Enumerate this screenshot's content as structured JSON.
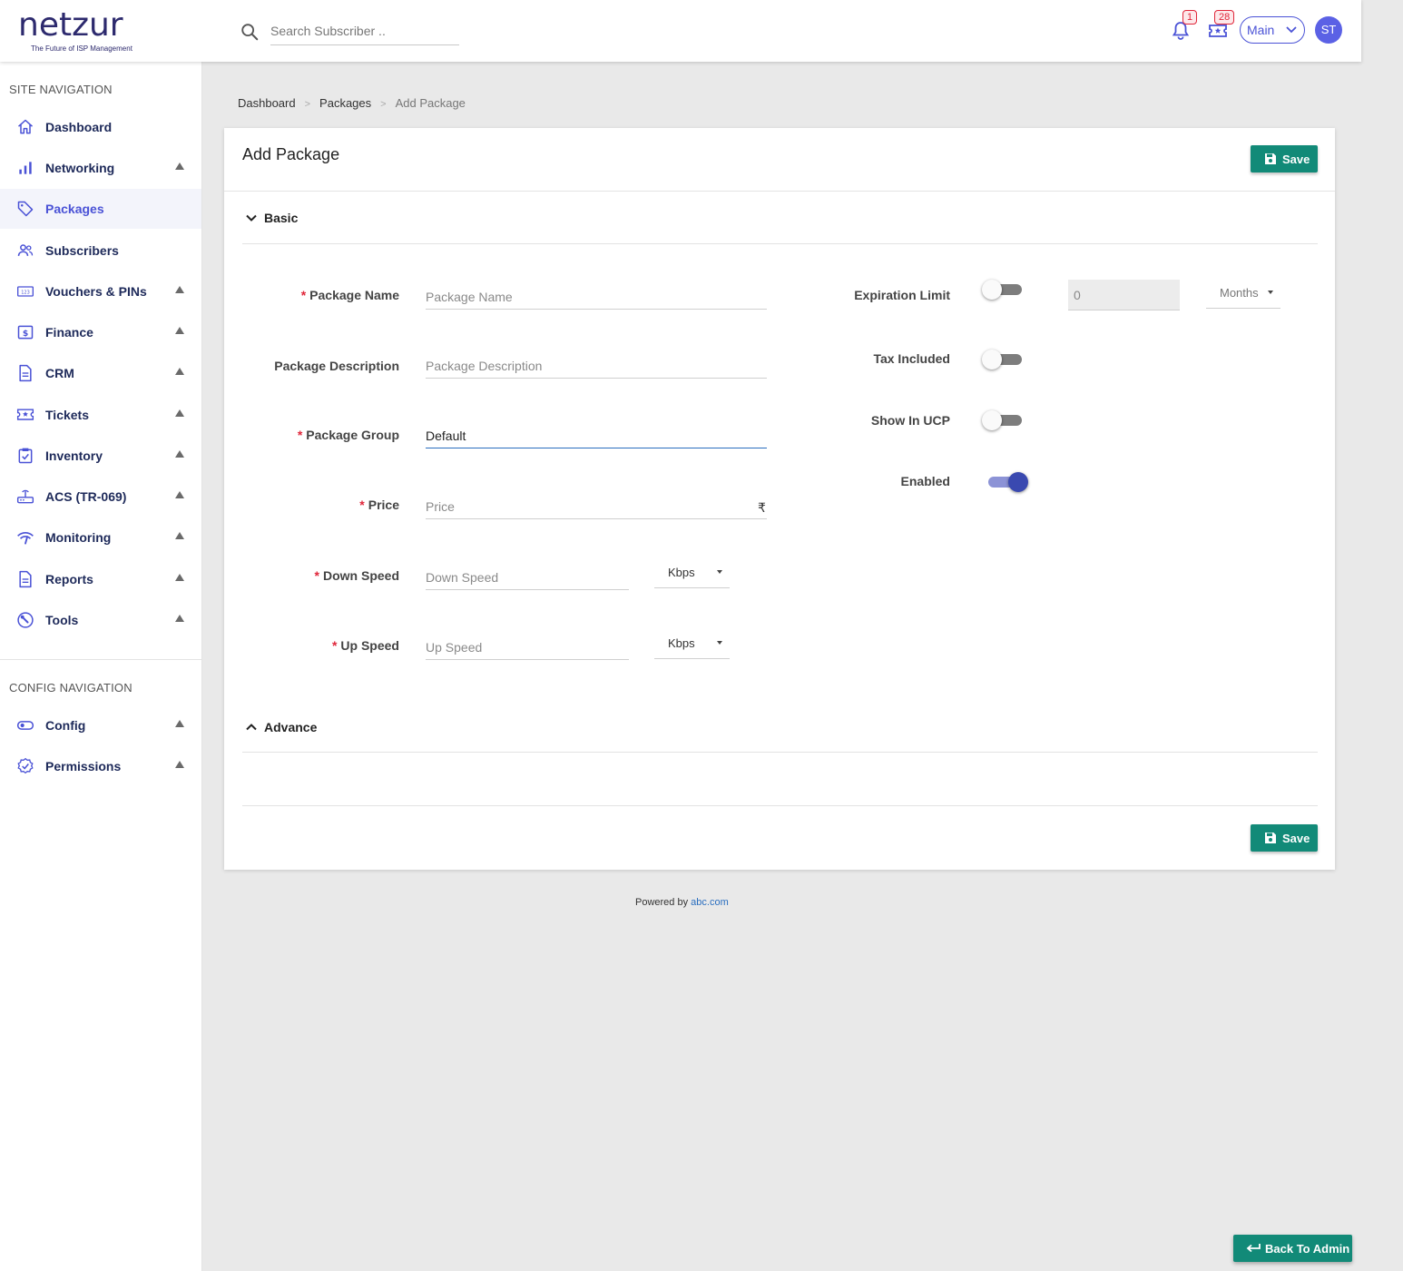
{
  "header": {
    "logo_text": "netzur",
    "logo_tagline": "The Future of ISP Management",
    "search_placeholder": "Search Subscriber ..",
    "notifications_count": "1",
    "tickets_count": "28",
    "branch_select": "Main",
    "avatar_initials": "ST"
  },
  "sidebar": {
    "site_nav_title": "SITE NAVIGATION",
    "items": [
      {
        "label": "Dashboard",
        "icon": "home-icon",
        "expandable": false,
        "active": false
      },
      {
        "label": "Networking",
        "icon": "bar-chart-icon",
        "expandable": true,
        "active": false
      },
      {
        "label": "Packages",
        "icon": "tag-icon",
        "expandable": false,
        "active": true
      },
      {
        "label": "Subscribers",
        "icon": "users-icon",
        "expandable": false,
        "active": false
      },
      {
        "label": "Vouchers & PINs",
        "icon": "voucher-icon",
        "expandable": true,
        "active": false
      },
      {
        "label": "Finance",
        "icon": "dollar-icon",
        "expandable": true,
        "active": false
      },
      {
        "label": "CRM",
        "icon": "document-icon",
        "expandable": true,
        "active": false
      },
      {
        "label": "Tickets",
        "icon": "ticket-icon",
        "expandable": true,
        "active": false
      },
      {
        "label": "Inventory",
        "icon": "clipboard-check-icon",
        "expandable": true,
        "active": false
      },
      {
        "label": "ACS (TR-069)",
        "icon": "router-icon",
        "expandable": true,
        "active": false
      },
      {
        "label": "Monitoring",
        "icon": "signal-icon",
        "expandable": true,
        "active": false
      },
      {
        "label": "Reports",
        "icon": "report-icon",
        "expandable": true,
        "active": false
      },
      {
        "label": "Tools",
        "icon": "wrench-icon",
        "expandable": true,
        "active": false
      }
    ],
    "config_nav_title": "CONFIG NAVIGATION",
    "config_items": [
      {
        "label": "Config",
        "icon": "toggle-icon",
        "expandable": true
      },
      {
        "label": "Permissions",
        "icon": "badge-check-icon",
        "expandable": true
      }
    ]
  },
  "breadcrumb": {
    "items": [
      "Dashboard",
      "Packages"
    ],
    "current": "Add Package"
  },
  "card": {
    "title": "Add Package",
    "save_label": "Save",
    "sections": {
      "basic": "Basic",
      "advance": "Advance"
    },
    "fields": {
      "package_name": {
        "label": "Package Name",
        "placeholder": "Package Name",
        "value": "",
        "required": true
      },
      "package_description": {
        "label": "Package Description",
        "placeholder": "Package Description",
        "value": "",
        "required": false
      },
      "package_group": {
        "label": "Package Group",
        "placeholder": "",
        "value": "Default",
        "required": true
      },
      "price": {
        "label": "Price",
        "placeholder": "Price",
        "value": "",
        "required": true,
        "currency_symbol": "₹"
      },
      "down_speed": {
        "label": "Down Speed",
        "placeholder": "Down Speed",
        "value": "",
        "required": true,
        "unit": "Kbps"
      },
      "up_speed": {
        "label": "Up Speed",
        "placeholder": "Up Speed",
        "value": "",
        "required": true,
        "unit": "Kbps"
      },
      "expiration_limit": {
        "label": "Expiration Limit",
        "enabled": false,
        "value": "0",
        "unit": "Months"
      },
      "tax_included": {
        "label": "Tax Included",
        "enabled": false
      },
      "show_in_ucp": {
        "label": "Show In UCP",
        "enabled": false
      },
      "enabled": {
        "label": "Enabled",
        "enabled": true
      }
    }
  },
  "footer": {
    "powered_by": "Powered by",
    "link_text": "abc.com"
  },
  "back_button": "Back To Admin",
  "colors": {
    "accent": "#4a52d6",
    "save_button": "#128a78",
    "required": "#e0263a",
    "nav_text": "#1e2a5a"
  }
}
